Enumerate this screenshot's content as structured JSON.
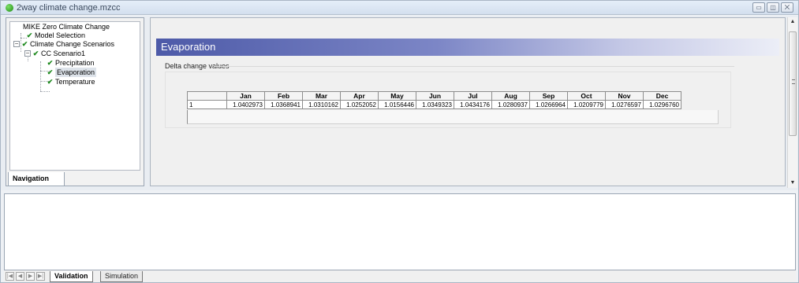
{
  "window": {
    "title": "2way climate change.mzcc",
    "buttons": [
      "minimize",
      "restore",
      "close"
    ]
  },
  "navigation": {
    "tab_label": "Navigation",
    "tree": [
      {
        "label": "MIKE Zero Climate Change",
        "level": 0,
        "checked": false
      },
      {
        "label": "Model Selection",
        "level": 1,
        "checked": true
      },
      {
        "label": "Climate Change Scenarios",
        "level": 1,
        "checked": true,
        "expander": "−"
      },
      {
        "label": "CC Scenario1",
        "level": 2,
        "checked": true,
        "expander": "−"
      },
      {
        "label": "Precipitation",
        "level": 3,
        "checked": true
      },
      {
        "label": "Evaporation",
        "level": 3,
        "checked": true,
        "selected": true
      },
      {
        "label": "Temperature",
        "level": 3,
        "checked": true
      }
    ]
  },
  "content": {
    "header_title": "Evaporation",
    "group_label": "Delta change values",
    "table": {
      "columns": [
        "",
        "Jan",
        "Feb",
        "Mar",
        "Apr",
        "May",
        "Jun",
        "Jul",
        "Aug",
        "Sep",
        "Oct",
        "Nov",
        "Dec"
      ],
      "rows": [
        [
          "1",
          "1.0402973",
          "1.0368941",
          "1.0310162",
          "1.0252052",
          "1.0156446",
          "1.0349323",
          "1.0434176",
          "1.0280937",
          "1.0266964",
          "1.0209779",
          "1.0276597",
          "1.0296760"
        ]
      ]
    }
  },
  "bottom_tabs": {
    "nav_buttons": [
      "|◀",
      "◀",
      "▶",
      "▶|"
    ],
    "tabs": [
      {
        "label": "Validation",
        "active": true
      },
      {
        "label": "Simulation",
        "active": false
      }
    ]
  },
  "colors": {
    "header_gradient_start": "#4d5aa8",
    "check_green": "#1f8a1f",
    "app_icon_green": "#3cb628"
  }
}
